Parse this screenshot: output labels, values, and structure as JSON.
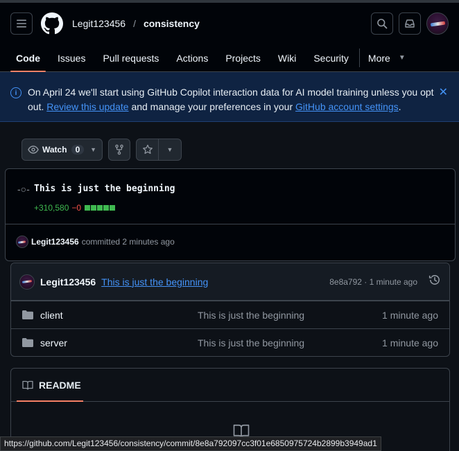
{
  "header": {
    "owner": "Legit123456",
    "separator": "/",
    "repo": "consistency"
  },
  "tabs": [
    {
      "label": "Code",
      "active": true
    },
    {
      "label": "Issues"
    },
    {
      "label": "Pull requests"
    },
    {
      "label": "Actions"
    },
    {
      "label": "Projects"
    },
    {
      "label": "Wiki"
    },
    {
      "label": "Security"
    },
    {
      "label": "More"
    }
  ],
  "banner": {
    "text_1": "On April 24 we'll start using GitHub Copilot interaction data for AI model training unless you opt out.",
    "link_1": "Review this update",
    "text_2": "and manage your preferences in your",
    "link_2": "GitHub account settings",
    "text_3": "."
  },
  "actions": {
    "watch_label": "Watch",
    "watch_count": "0"
  },
  "commit": {
    "title": "This is just the beginning",
    "additions": "+310,580",
    "deletions": "−0",
    "author": "Legit123456",
    "meta": "committed 2 minutes ago"
  },
  "files_header": {
    "author": "Legit123456",
    "message": "This is just the beginning",
    "sha_age": "8e8a792 · 1 minute ago"
  },
  "files": [
    {
      "name": "client",
      "message": "This is just the beginning",
      "age": "1 minute ago"
    },
    {
      "name": "server",
      "message": "This is just the beginning",
      "age": "1 minute ago"
    }
  ],
  "readme": {
    "title": "README"
  },
  "status_url": "https://github.com/Legit123456/consistency/commit/8e8a792097cc3f01e6850975724b2899b3949ad1",
  "colors": {
    "accent": "#f78166",
    "link": "#4493f8",
    "added": "#3fb950",
    "deleted": "#f85149"
  }
}
